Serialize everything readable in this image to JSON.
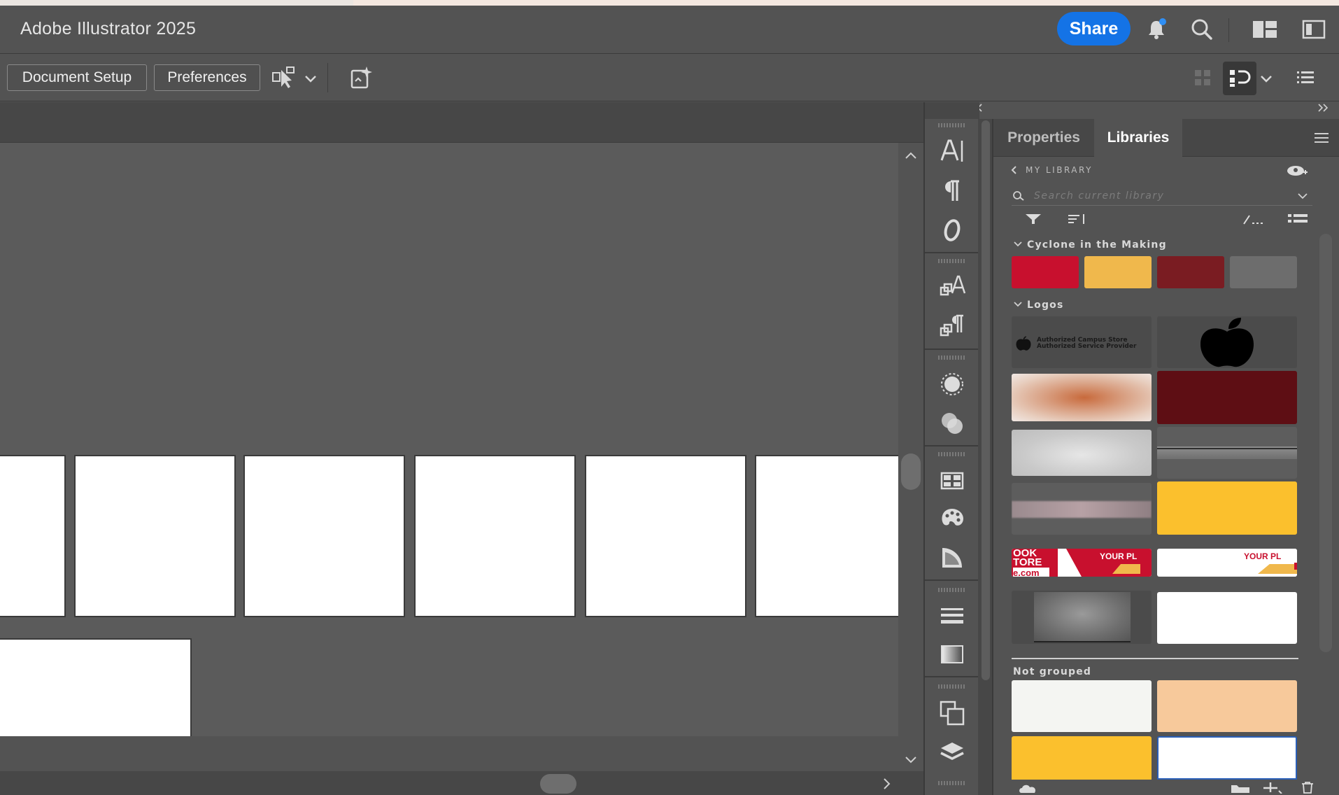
{
  "app": {
    "title": "Adobe Illustrator 2025",
    "share_label": "Share"
  },
  "controlbar": {
    "document_setup": "Document Setup",
    "preferences": "Preferences"
  },
  "panel": {
    "tabs": [
      {
        "label": "Properties"
      },
      {
        "label": "Libraries"
      }
    ],
    "library_name": "MY LIBRARY",
    "search_placeholder": "Search current library",
    "groups": [
      {
        "name": "Cyclone in the Making",
        "colors": [
          "#c8102e",
          "#f0b84c",
          "#7a1c22",
          "#6d6d6d"
        ]
      },
      {
        "name": "Logos"
      },
      {
        "name": "Not grouped",
        "colors": [
          "#f4f5f2",
          "#f7c99b",
          "#fbc02d",
          "#ffffff"
        ]
      }
    ],
    "logo_texts": {
      "campus_line1": "Authorized Campus Store",
      "campus_line2": "Authorized Service Provider",
      "banner_left_top": "OOK",
      "banner_left_mid": "TORE",
      "banner_left_bot": "e.com",
      "banner_your": "YOUR PL"
    }
  },
  "colors": {
    "share": "#1473e6",
    "ui_bg": "#535353",
    "ui_dark": "#474747",
    "artboard": "#ffffff"
  }
}
